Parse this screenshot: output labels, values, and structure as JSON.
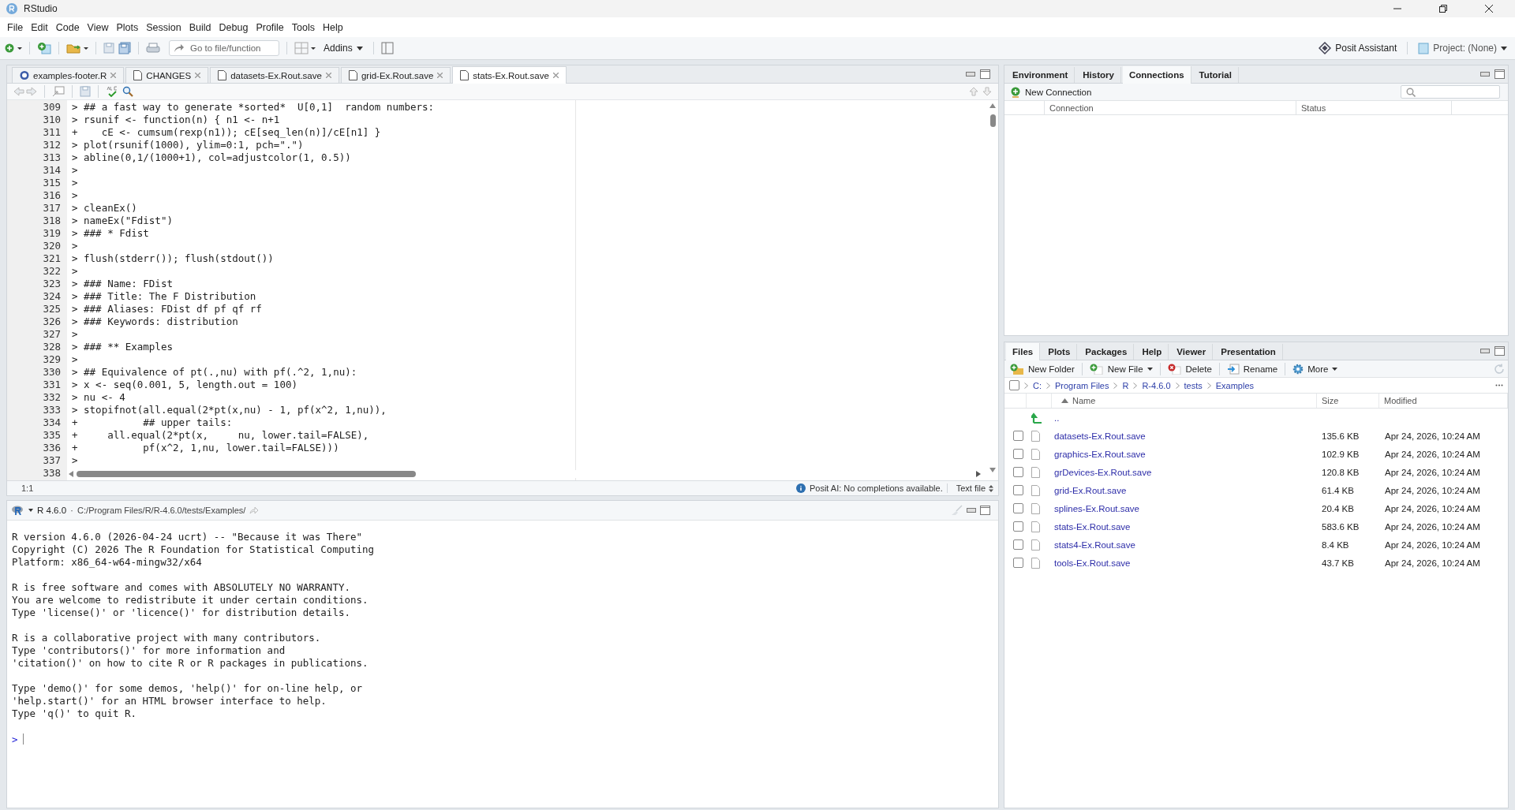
{
  "window": {
    "title": "RStudio"
  },
  "menu": [
    "File",
    "Edit",
    "Code",
    "View",
    "Plots",
    "Session",
    "Build",
    "Debug",
    "Profile",
    "Tools",
    "Help"
  ],
  "toolbar": {
    "goto_placeholder": "Go to file/function",
    "addins": "Addins",
    "assistant": "Posit Assistant",
    "project": "Project: (None)"
  },
  "editor": {
    "tabs": [
      {
        "label": "examples-footer.R",
        "kind": "r_script",
        "selected": false
      },
      {
        "label": "CHANGES",
        "kind": "text",
        "selected": false
      },
      {
        "label": "datasets-Ex.Rout.save",
        "kind": "text",
        "selected": false
      },
      {
        "label": "grid-Ex.Rout.save",
        "kind": "text",
        "selected": false
      },
      {
        "label": "stats-Ex.Rout.save",
        "kind": "text",
        "selected": true
      }
    ],
    "lines": [
      {
        "number": "309",
        "text": "> ## a fast way to generate *sorted*  U[0,1]  random numbers:"
      },
      {
        "number": "310",
        "text": "> rsunif <- function(n) { n1 <- n+1"
      },
      {
        "number": "311",
        "text": "+    cE <- cumsum(rexp(n1)); cE[seq_len(n)]/cE[n1] }"
      },
      {
        "number": "312",
        "text": "> plot(rsunif(1000), ylim=0:1, pch=\".\")"
      },
      {
        "number": "313",
        "text": "> abline(0,1/(1000+1), col=adjustcolor(1, 0.5))"
      },
      {
        "number": "314",
        "text": ">"
      },
      {
        "number": "315",
        "text": ">"
      },
      {
        "number": "316",
        "text": ">"
      },
      {
        "number": "317",
        "text": "> cleanEx()"
      },
      {
        "number": "318",
        "text": "> nameEx(\"Fdist\")"
      },
      {
        "number": "319",
        "text": "> ### * Fdist"
      },
      {
        "number": "320",
        "text": ">"
      },
      {
        "number": "321",
        "text": "> flush(stderr()); flush(stdout())"
      },
      {
        "number": "322",
        "text": ">"
      },
      {
        "number": "323",
        "text": "> ### Name: FDist"
      },
      {
        "number": "324",
        "text": "> ### Title: The F Distribution"
      },
      {
        "number": "325",
        "text": "> ### Aliases: FDist df pf qf rf"
      },
      {
        "number": "326",
        "text": "> ### Keywords: distribution"
      },
      {
        "number": "327",
        "text": ">"
      },
      {
        "number": "328",
        "text": "> ### ** Examples"
      },
      {
        "number": "329",
        "text": ">"
      },
      {
        "number": "330",
        "text": "> ## Equivalence of pt(.,nu) with pf(.^2, 1,nu):"
      },
      {
        "number": "331",
        "text": "> x <- seq(0.001, 5, length.out = 100)"
      },
      {
        "number": "332",
        "text": "> nu <- 4"
      },
      {
        "number": "333",
        "text": "> stopifnot(all.equal(2*pt(x,nu) - 1, pf(x^2, 1,nu)),"
      },
      {
        "number": "334",
        "text": "+           ## upper tails:"
      },
      {
        "number": "335",
        "text": "+     all.equal(2*pt(x,     nu, lower.tail=FALSE),"
      },
      {
        "number": "336",
        "text": "+           pf(x^2, 1,nu, lower.tail=FALSE)))"
      },
      {
        "number": "337",
        "text": ">"
      },
      {
        "number": "338"
      }
    ],
    "status": {
      "position": "1:1",
      "ai_message": "Posit AI: No completions available.",
      "file_type": "Text file"
    }
  },
  "console": {
    "version": "R 4.6.0",
    "separator": "·",
    "path": "C:/Program Files/R/R-4.6.0/tests/Examples/",
    "paragraphs": [
      [
        "R version 4.6.0 (2026-04-24 ucrt) -- \"Because it was There\"",
        "Copyright (C) 2026 The R Foundation for Statistical Computing",
        "Platform: x86_64-w64-mingw32/x64"
      ],
      [
        "R is free software and comes with ABSOLUTELY NO WARRANTY.",
        "You are welcome to redistribute it under certain conditions.",
        "Type 'license()' or 'licence()' for distribution details."
      ],
      [
        "R is a collaborative project with many contributors.",
        "Type 'contributors()' for more information and",
        "'citation()' on how to cite R or R packages in publications."
      ],
      [
        "Type 'demo()' for some demos, 'help()' for on-line help, or",
        "'help.start()' for an HTML browser interface to help.",
        "Type 'q()' to quit R."
      ]
    ],
    "prompt": ">"
  },
  "environment_pane": {
    "tabs": [
      {
        "label": "Environment",
        "selected": false
      },
      {
        "label": "History",
        "selected": false
      },
      {
        "label": "Connections",
        "selected": true
      },
      {
        "label": "Tutorial",
        "selected": false
      }
    ],
    "new_connection": "New Connection",
    "columns": [
      "Connection",
      "Status"
    ]
  },
  "files_pane": {
    "tabs": [
      {
        "label": "Files",
        "selected": true
      },
      {
        "label": "Plots",
        "selected": false
      },
      {
        "label": "Packages",
        "selected": false
      },
      {
        "label": "Help",
        "selected": false
      },
      {
        "label": "Viewer",
        "selected": false
      },
      {
        "label": "Presentation",
        "selected": false
      }
    ],
    "actions": [
      {
        "label": "New Folder",
        "kind": "new_folder",
        "dropdown": false
      },
      {
        "label": "New File",
        "kind": "new_file",
        "dropdown": true
      },
      {
        "label": "Delete",
        "kind": "delete",
        "dropdown": false
      },
      {
        "label": "Rename",
        "kind": "rename",
        "dropdown": false
      },
      {
        "label": "More",
        "kind": "more",
        "dropdown": true
      }
    ],
    "select_all_checked": false,
    "breadcrumbs": [
      "C:",
      "Program Files",
      "R",
      "R-4.6.0",
      "tests",
      "Examples"
    ],
    "columns": [
      {
        "label": "Name",
        "sorted": true
      },
      {
        "label": "Size",
        "sorted": false
      },
      {
        "label": "Modified",
        "sorted": false
      }
    ],
    "parent": "..",
    "files": [
      {
        "name": "datasets-Ex.Rout.save",
        "size": "135.6 KB",
        "modified": "Apr 24, 2026, 10:24 AM",
        "checked": false
      },
      {
        "name": "graphics-Ex.Rout.save",
        "size": "102.9 KB",
        "modified": "Apr 24, 2026, 10:24 AM",
        "checked": false
      },
      {
        "name": "grDevices-Ex.Rout.save",
        "size": "120.8 KB",
        "modified": "Apr 24, 2026, 10:24 AM",
        "checked": false
      },
      {
        "name": "grid-Ex.Rout.save",
        "size": "61.4 KB",
        "modified": "Apr 24, 2026, 10:24 AM",
        "checked": false
      },
      {
        "name": "splines-Ex.Rout.save",
        "size": "20.4 KB",
        "modified": "Apr 24, 2026, 10:24 AM",
        "checked": false
      },
      {
        "name": "stats-Ex.Rout.save",
        "size": "583.6 KB",
        "modified": "Apr 24, 2026, 10:24 AM",
        "checked": false
      },
      {
        "name": "stats4-Ex.Rout.save",
        "size": "8.4 KB",
        "modified": "Apr 24, 2026, 10:24 AM",
        "checked": false
      },
      {
        "name": "tools-Ex.Rout.save",
        "size": "43.7 KB",
        "modified": "Apr 24, 2026, 10:24 AM",
        "checked": false
      }
    ]
  }
}
